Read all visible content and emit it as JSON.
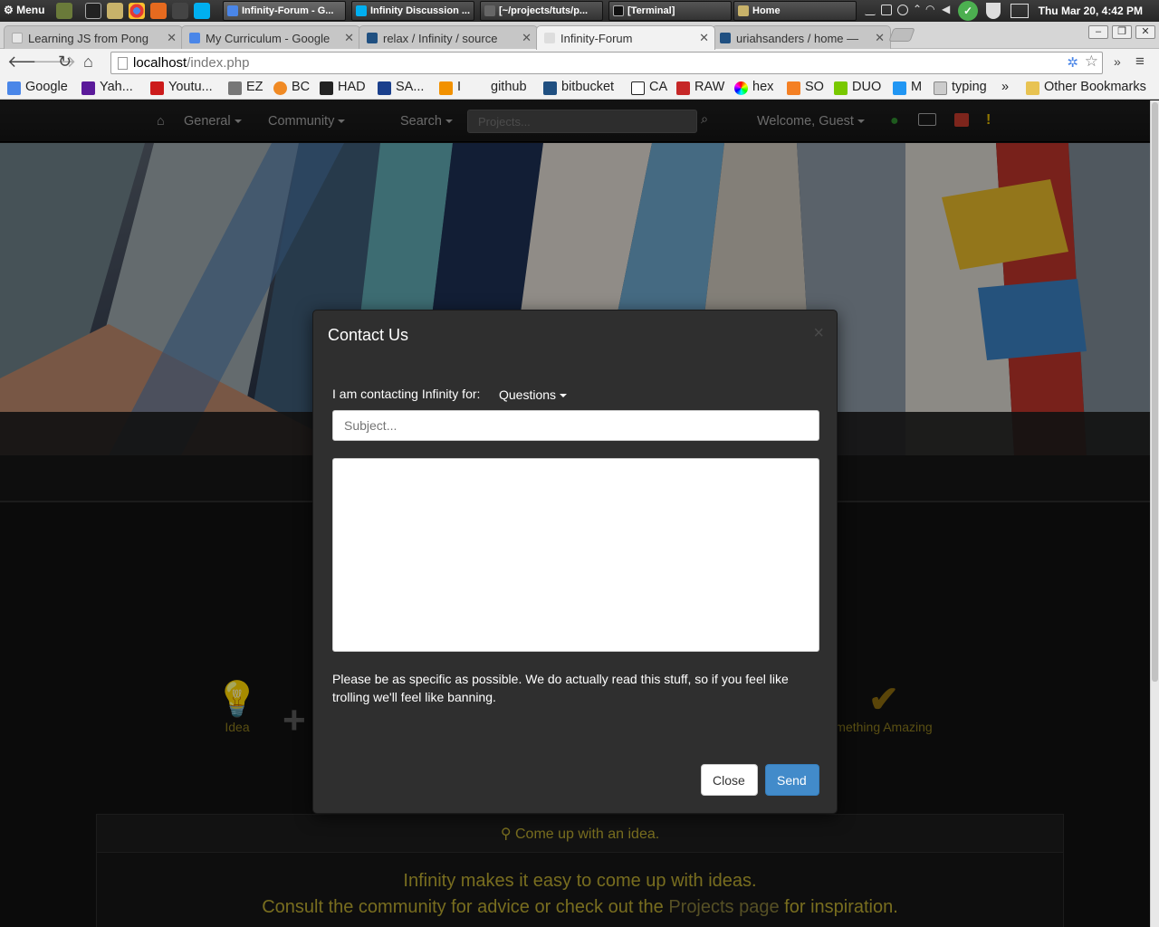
{
  "taskbar": {
    "menu_label": "Menu",
    "tasks": [
      "Infinity-Forum - G...",
      "Infinity Discussion ...",
      "[~/projects/tuts/p...",
      "[Terminal]",
      "Home"
    ],
    "clock": "Thu Mar 20,  4:42 PM"
  },
  "browser": {
    "tabs": [
      {
        "label": "Learning JS from Pong",
        "color": "#e6e6e6"
      },
      {
        "label": "My Curriculum - Google",
        "color": "#4a86e8"
      },
      {
        "label": "relax / Infinity / source",
        "color": "#205081"
      },
      {
        "label": "Infinity-Forum",
        "color": "#dddddd"
      },
      {
        "label": "uriahsanders / home —",
        "color": "#205081"
      }
    ],
    "url_host": "localhost",
    "url_path": "/index.php",
    "bookmarks": [
      {
        "label": "Google",
        "color": "#4a86e8"
      },
      {
        "label": "Yah...",
        "color": "#5b1a9a"
      },
      {
        "label": "Youtu...",
        "color": "#cc1b1b"
      },
      {
        "label": "EZ",
        "color": "#777777"
      },
      {
        "label": "BC",
        "color": "#f08a24"
      },
      {
        "label": "HAD",
        "color": "#222222"
      },
      {
        "label": "SA...",
        "color": "#1a3f8c"
      },
      {
        "label": "I",
        "color": "#f29100"
      },
      {
        "label": "github",
        "color": "#333333"
      },
      {
        "label": "bitbucket",
        "color": "#205081"
      },
      {
        "label": "CA",
        "color": "#222222"
      },
      {
        "label": "RAW",
        "color": "#c62828"
      },
      {
        "label": "hex",
        "color": "#8e44ad"
      },
      {
        "label": "SO",
        "color": "#f48024"
      },
      {
        "label": "DUO",
        "color": "#78c800"
      },
      {
        "label": "M",
        "color": "#2196f3"
      },
      {
        "label": "typing",
        "color": "#cccccc"
      }
    ],
    "overflow": "»",
    "other_bookmarks": "Other Bookmarks"
  },
  "site": {
    "nav": {
      "general": "General",
      "community": "Community",
      "search": "Search",
      "projects_placeholder": "Projects...",
      "welcome": "Welcome, Guest"
    },
    "steps": {
      "idea": "Idea",
      "amazing": "mething Amazing"
    },
    "panel": {
      "heading": "Come up with an idea.",
      "line1": "Infinity makes it easy to come up with ideas.",
      "line2_before": "Consult the community for advice or check out the ",
      "line2_link": "Projects page",
      "line2_after": " for inspiration."
    }
  },
  "modal": {
    "title": "Contact Us",
    "close_x": "×",
    "reason_label": "I am contacting Infinity for:",
    "reason_value": "Questions",
    "subject_placeholder": "Subject...",
    "help_text": "Please be as specific as possible. We do actually read this stuff, so if you feel like trolling we'll feel like banning.",
    "close_button": "Close",
    "send_button": "Send"
  },
  "colors": {
    "accent_blue": "#428bca",
    "gold_text": "#b8a830",
    "user_icon": "#2e8b2e",
    "archive_icon": "#c0392b",
    "alert_icon": "#e0b800"
  }
}
